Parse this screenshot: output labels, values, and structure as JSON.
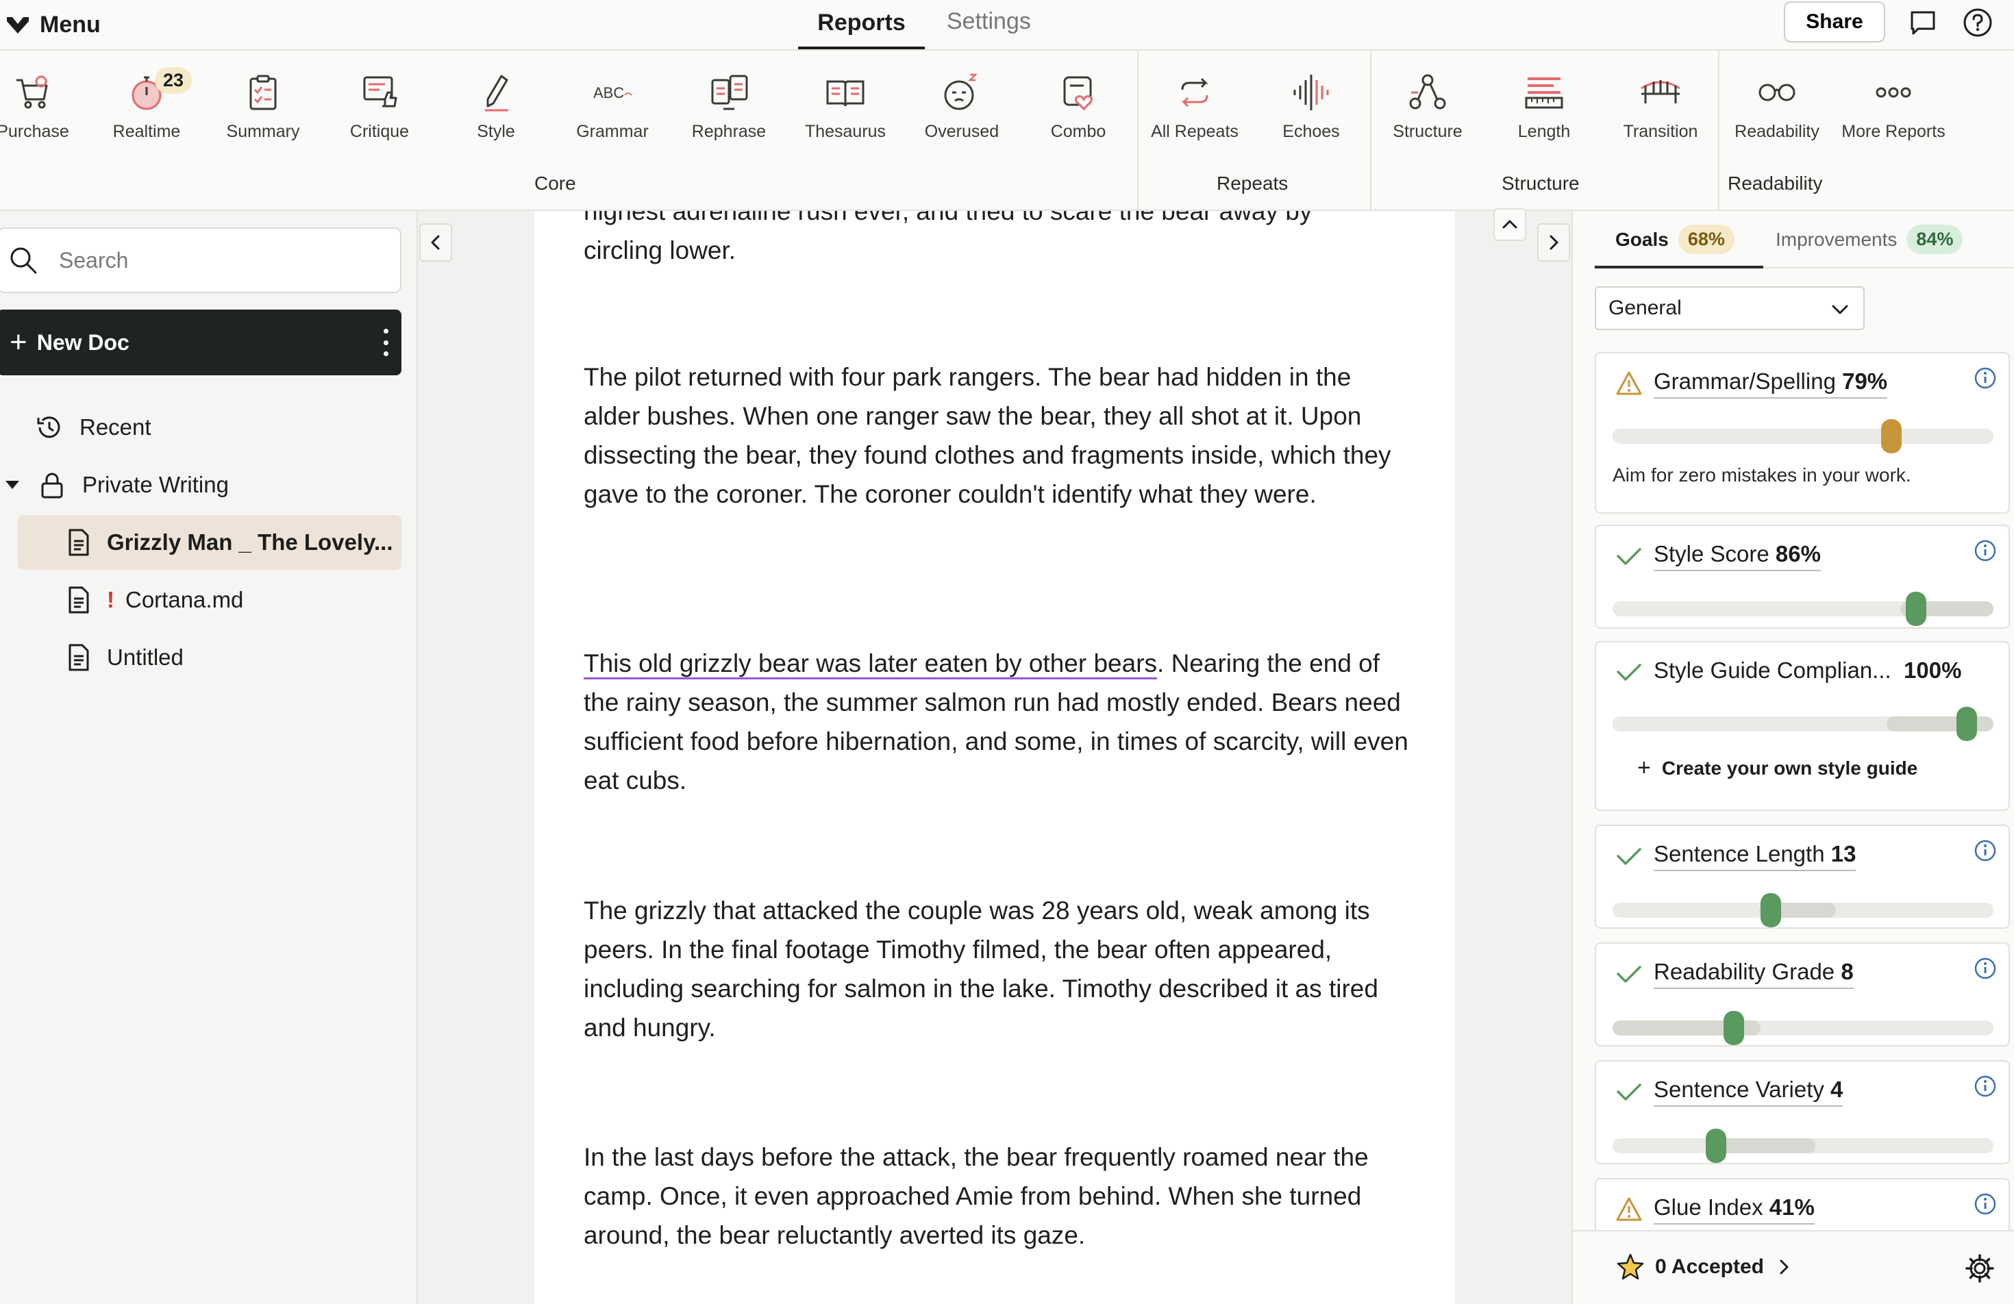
{
  "topbar": {
    "menu_label": "Menu",
    "tabs": [
      {
        "label": "Reports"
      },
      {
        "label": "Settings"
      }
    ],
    "share_label": "Share"
  },
  "ribbon": {
    "items": [
      {
        "label": "Purchase",
        "icon": "cart-icon"
      },
      {
        "label": "Realtime",
        "icon": "stopwatch-icon",
        "badge": "23"
      },
      {
        "label": "Summary",
        "icon": "clipboard-icon"
      },
      {
        "label": "Critique",
        "icon": "thumbs-up-icon"
      },
      {
        "label": "Style",
        "icon": "pencil-icon"
      },
      {
        "label": "Grammar",
        "icon": "abc-icon",
        "icon_text": "ABC"
      },
      {
        "label": "Rephrase",
        "icon": "rephrase-icon"
      },
      {
        "label": "Thesaurus",
        "icon": "book-icon"
      },
      {
        "label": "Overused",
        "icon": "sleepy-face-icon"
      },
      {
        "label": "Combo",
        "icon": "heart-clipboard-icon"
      },
      {
        "label": "All Repeats",
        "icon": "repeat-icon"
      },
      {
        "label": "Echoes",
        "icon": "soundwave-icon"
      },
      {
        "label": "Structure",
        "icon": "structure-icon"
      },
      {
        "label": "Length",
        "icon": "ruler-icon"
      },
      {
        "label": "Transition",
        "icon": "bridge-icon"
      },
      {
        "label": "Readability",
        "icon": "glasses-icon"
      },
      {
        "label": "More Reports",
        "icon": "more-icon"
      }
    ],
    "groups": [
      "Core",
      "Repeats",
      "Structure",
      "Readability"
    ]
  },
  "sidebar": {
    "search_placeholder": "Search",
    "new_doc_label": "New Doc",
    "items": [
      {
        "label": "Recent"
      },
      {
        "label": "Private Writing"
      },
      {
        "label": "Grizzly Man _ The Lovely..."
      },
      {
        "label": "Cortana.md",
        "warning": "!"
      },
      {
        "label": "Untitled"
      }
    ]
  },
  "editor": {
    "paragraphs": [
      {
        "text": "highest adrenaline rush ever, and tried to scare the bear away by"
      },
      {
        "text": "circling lower."
      },
      {
        "text": "The pilot returned with four park rangers. The bear had hidden in the alder bushes. When one ranger saw the bear, they all shot at it. Upon dissecting the bear, they found clothes and fragments inside, which they gave to the coroner. The coroner couldn't identify what they were."
      },
      {
        "highlight": "This old grizzly bear was later eaten by other bears",
        "text": ". Nearing the end of the rainy season, the summer salmon run had mostly ended. Bears need sufficient food before hibernation, and some, in times of scarcity, will even eat cubs."
      },
      {
        "text": "The grizzly that attacked the couple was 28 years old, weak among its peers. In the final footage Timothy filmed, the bear often appeared, including searching for salmon in the lake. Timothy described it as tired and hungry."
      },
      {
        "text": "In the last days before the attack, the bear frequently roamed near the camp. Once, it even approached Amie from behind. When she turned around, the bear reluctantly averted its gaze."
      }
    ]
  },
  "panel": {
    "tabs": [
      {
        "label": "Goals",
        "pct": "68%"
      },
      {
        "label": "Improvements",
        "pct": "84%"
      }
    ],
    "dropdown_value": "General",
    "cards": [
      {
        "label": "Grammar/Spelling",
        "value": "79%",
        "status": "warning",
        "note": "Aim for zero mistakes in your work.",
        "level": 0.79
      },
      {
        "label": "Style Score",
        "value": "86%",
        "status": "ok",
        "level": 0.86
      },
      {
        "label": "Style Guide Complian...",
        "value": "100%",
        "status": "ok",
        "action": "Create your own style guide",
        "level": 1.0
      },
      {
        "label": "Sentence Length",
        "value": "13",
        "status": "ok"
      },
      {
        "label": "Readability Grade",
        "value": "8",
        "status": "ok"
      },
      {
        "label": "Sentence Variety",
        "value": "4",
        "status": "ok"
      },
      {
        "label": "Glue Index",
        "value": "41%",
        "status": "warning"
      }
    ],
    "accepted_label": "0 Accepted"
  },
  "colors": {
    "accent_green": "#5b9a5e",
    "accent_amber": "#c8963a",
    "icon_pink": "#e46b6b",
    "highlight_purple": "#9b59d8"
  }
}
